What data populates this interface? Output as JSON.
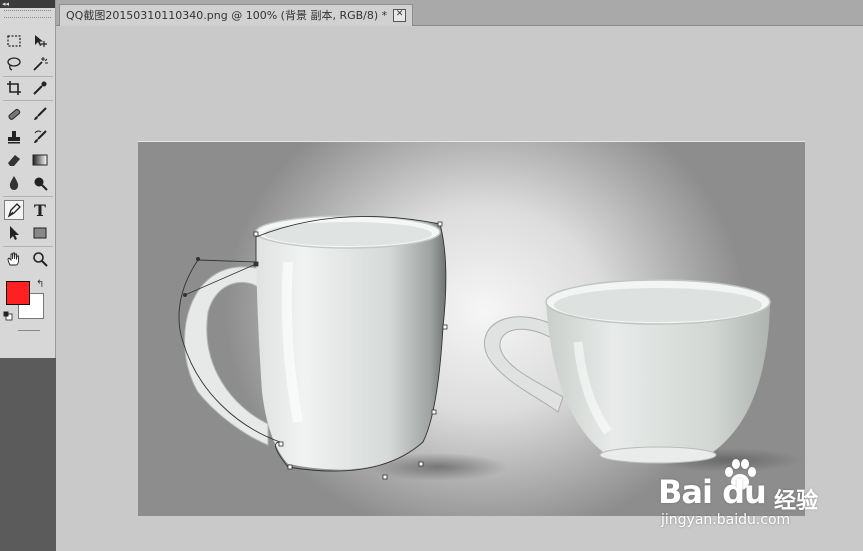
{
  "app": {
    "panel_collapse": "◂◂"
  },
  "document_tab": {
    "title": "QQ截图20150310110340.png @ 100% (背景 副本, RGB/8) *",
    "close": "✕"
  },
  "toolbox": {
    "active_tool": "pen",
    "tools": [
      {
        "name": "rectangular-marquee",
        "icon": "marquee-icon"
      },
      {
        "name": "move",
        "icon": "move-icon"
      },
      {
        "name": "lasso",
        "icon": "lasso-icon"
      },
      {
        "name": "magic-wand",
        "icon": "magic-wand-icon"
      },
      {
        "name": "crop",
        "icon": "crop-icon"
      },
      {
        "name": "eyedropper",
        "icon": "eyedropper-icon"
      },
      {
        "name": "healing-brush",
        "icon": "bandage-icon"
      },
      {
        "name": "brush",
        "icon": "brush-icon"
      },
      {
        "name": "clone-stamp",
        "icon": "stamp-icon"
      },
      {
        "name": "history-brush",
        "icon": "history-brush-icon"
      },
      {
        "name": "eraser",
        "icon": "eraser-icon"
      },
      {
        "name": "gradient",
        "icon": "gradient-icon"
      },
      {
        "name": "blur",
        "icon": "drop-icon"
      },
      {
        "name": "dodge",
        "icon": "dodge-icon"
      },
      {
        "name": "pen",
        "icon": "pen-icon"
      },
      {
        "name": "type",
        "icon": "type-icon"
      },
      {
        "name": "path-selection",
        "icon": "arrow-icon"
      },
      {
        "name": "rectangle",
        "icon": "rectangle-icon"
      },
      {
        "name": "hand",
        "icon": "hand-icon"
      },
      {
        "name": "zoom",
        "icon": "zoom-icon"
      }
    ],
    "type_glyph": "T",
    "swap_glyph": "↰",
    "foreground_color": "#ff2121",
    "background_color": "#ffffff"
  },
  "watermark": {
    "brand": "Bai du",
    "brand_cn": "经验",
    "url": "jingyan.baidu.com"
  }
}
